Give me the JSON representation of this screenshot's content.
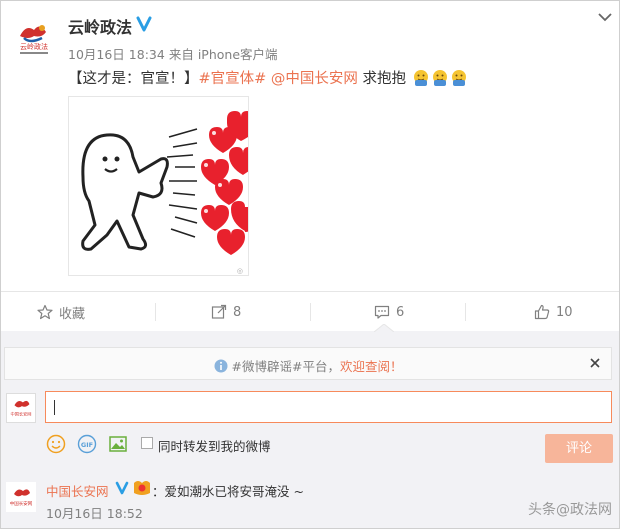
{
  "post": {
    "username": "云岭政法",
    "avatar_text": "云岭政法",
    "date": "10月16日 18:34",
    "source_prefix": "来自",
    "source": "iPhone客户端",
    "content": {
      "bracket_text": "【这才是：官宣！】",
      "hashtag": "#官宣体#",
      "mention": "@中国长安网",
      "tail": " 求抱抱"
    },
    "emojis": [
      "hug-emoji",
      "hug-emoji",
      "hug-emoji"
    ]
  },
  "actions": {
    "favorite_label": "收藏",
    "repost_count": "8",
    "comment_count": "6",
    "like_count": "10"
  },
  "notice": {
    "pre": "#微博辟谣#平台，",
    "highlight": "欢迎查阅！"
  },
  "composer": {
    "input_value": "",
    "forward_label": "同时转发到我的微博",
    "submit_label": "评论",
    "my_avatar_text": "中国长安网"
  },
  "comment": {
    "username": "中国长安网",
    "text": "：爱如潮水已将安哥淹没 ~",
    "time": "10月16日 18:52",
    "avatar_text": "中国长安网"
  },
  "watermark": "头条@政法网",
  "colors": {
    "accent": "#eb7350",
    "verified": "#2a9ee4",
    "submit_disabled": "#f7b59a",
    "comment_bg": "#f2f2f5"
  }
}
